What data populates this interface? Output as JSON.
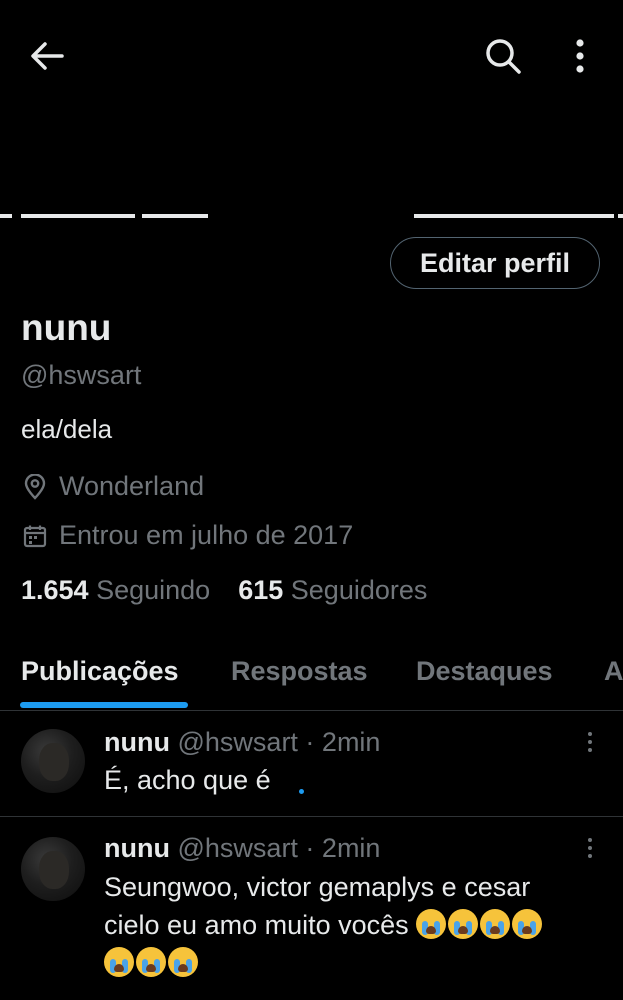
{
  "header": {
    "back_icon": "arrow-left-icon",
    "search_icon": "search-icon",
    "more_icon": "more-vertical-icon"
  },
  "profile": {
    "edit_button": "Editar perfil",
    "name": "nunu",
    "handle": "@hswsart",
    "bio": "ela/dela",
    "location": "Wonderland",
    "joined": "Entrou em julho de 2017",
    "following_count": "1.654",
    "following_label": "Seguindo",
    "followers_count": "615",
    "followers_label": "Seguidores"
  },
  "tabs": [
    {
      "label": "Publicações",
      "active": true
    },
    {
      "label": "Respostas",
      "active": false
    },
    {
      "label": "Destaques",
      "active": false
    },
    {
      "label": "A",
      "active": false
    }
  ],
  "posts": [
    {
      "name": "nunu",
      "handle_time": "@hswsart · 2min",
      "text": "É, acho que é"
    },
    {
      "name": "nunu",
      "handle_time": "@hswsart · 2min",
      "text_line1": "Seungwoo, victor gemaplys e cesar",
      "text_line2": "cielo eu amo muito vocês",
      "emoji": "loudly-crying-face",
      "emoji_count_line2": 4,
      "emoji_count_line3": 3
    }
  ],
  "colors": {
    "background": "#000000",
    "text_primary": "#e7e9ea",
    "text_secondary": "#71767b",
    "accent": "#1d9bf0",
    "border": "#2f3336"
  }
}
